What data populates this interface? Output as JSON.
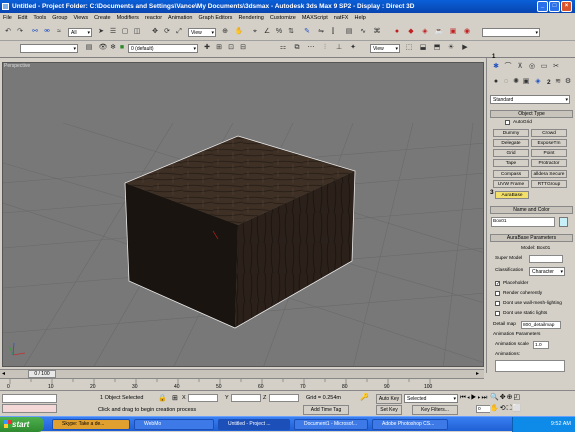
{
  "window": {
    "title": "Untitled   - Project Folder: C:\\Documents and Settings\\Vance\\My Documents\\3dsmax     - Autodesk 3ds Max 9 SP2        - Display : Direct 3D",
    "min": "_",
    "max": "□",
    "close": "×"
  },
  "menu": [
    "File",
    "Edit",
    "Tools",
    "Group",
    "Views",
    "Create",
    "Modifiers",
    "reactor",
    "Animation",
    "Graph Editors",
    "Rendering",
    "Customize",
    "MAXScript",
    "natFX",
    "Help"
  ],
  "toolbar": {
    "selection_filter": "All",
    "view_dropdown": "View",
    "layer_dropdown": "0 (default)",
    "view_dropdown2": "View",
    "named_selection": ""
  },
  "viewport": {
    "label": "Perspective",
    "axis_x": "x",
    "axis_y": "y",
    "axis_z": "z"
  },
  "command_panel": {
    "category": "Standard",
    "object_type_header": "Object Type",
    "autogrid": "AutoGrid",
    "buttons": [
      "Dummy",
      "Crowd",
      "Delegate",
      "ExposeTm",
      "Grid",
      "Point",
      "Tape",
      "Protractor",
      "Compass",
      "alldera Secure",
      "UVW Frame",
      "RTTGroup",
      "AuraBase"
    ],
    "name_color_header": "Name and Color",
    "object_name": "Box01",
    "params_header": "AuraBase Parameters",
    "model_label": "Model: Box01",
    "super_model_label": "Super Model",
    "classification_label": "Classification",
    "classification_value": "Character",
    "placeholder": "Placeholder",
    "render_coherently": "Render coherently",
    "dont_use_wallmesh": "Dont use wall-mesh-lighting",
    "dont_use_static": "Dont use static lights",
    "detail_map_label": "Detail map",
    "detail_map_value": "800_detailmap",
    "anim_params_label": "Animation Parameters",
    "anim_scale_label": "Animation scale",
    "anim_scale_value": "1.0",
    "animations_label": "Animations:",
    "badge1": "1",
    "badge2": "2",
    "badge3": "3"
  },
  "timeline": {
    "position": "0 / 100",
    "ticks": [
      "0",
      "10",
      "20",
      "30",
      "40",
      "50",
      "60",
      "70",
      "80",
      "90",
      "100"
    ]
  },
  "status": {
    "selected": "1 Object Selected",
    "prompt": "Click and drag to begin creation process",
    "x_label": "X",
    "y_label": "Y",
    "z_label": "Z",
    "grid": "Grid = 0.254m",
    "add_time_tag": "Add Time Tag",
    "auto_key": "Auto Key",
    "set_key": "Set Key",
    "key_mode": "Selected",
    "key_filters": "Key Filters...",
    "frame": "0"
  },
  "taskbar": {
    "start": "start",
    "tasks": [
      "Skype: Take a de...",
      "WebMo",
      "Untitled    - Project ...",
      "Document1 - Microsof...",
      "Adobe Photoshop CS..."
    ],
    "time": "9:52 AM"
  },
  "colors": {
    "box_top": "#3e3025",
    "box_front": "#2b211a",
    "box_left": "#1a1410",
    "viewport_bg": "#787878",
    "selected_btn": "#f2e06a",
    "title_blue": "#0a5fd8"
  }
}
